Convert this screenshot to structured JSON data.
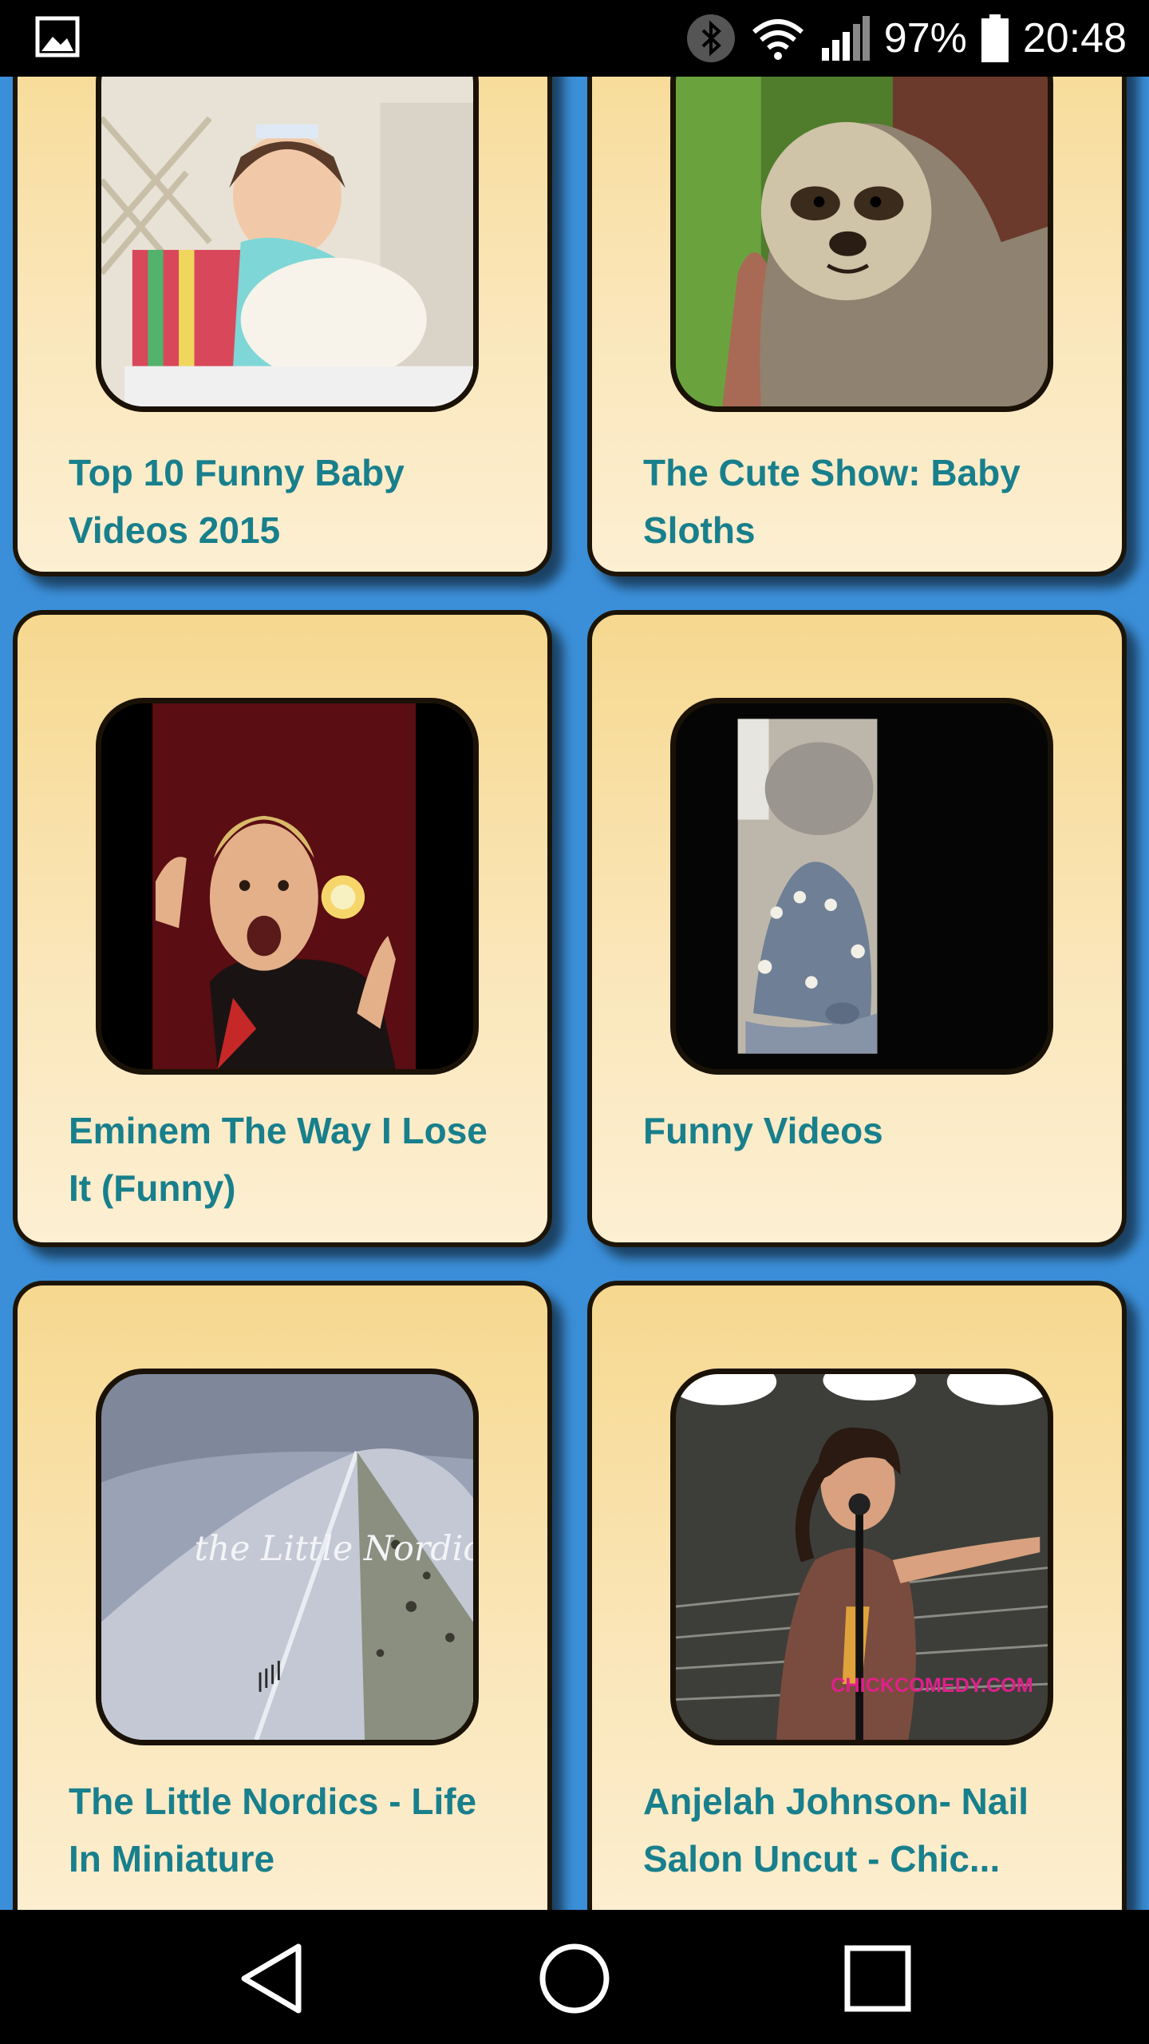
{
  "status_bar": {
    "battery_percent": "97%",
    "time": "20:48",
    "icons": [
      "gallery-notification-icon",
      "bluetooth-icon",
      "wifi-icon",
      "cell-signal-icon",
      "battery-icon"
    ]
  },
  "videos": [
    {
      "title": "Top 10 Funny Baby Videos 2015",
      "thumbnail": "baby-eating-cake"
    },
    {
      "title": "The Cute Show: Baby Sloths",
      "thumbnail": "baby-sloth"
    },
    {
      "title": "Eminem The Way I Lose It (Funny)",
      "thumbnail": "eminem-music-video"
    },
    {
      "title": "Funny Videos",
      "thumbnail": "cake-in-dark-frame"
    },
    {
      "title": "The Little Nordics - Life In Miniature",
      "thumbnail": "snowy-mountain",
      "thumbnail_overlay_text": "the Little Nordics"
    },
    {
      "title": "Anjelah Johnson- Nail Salon Uncut - Chic...",
      "thumbnail": "comedian-on-stage",
      "thumbnail_overlay_text": "CHICKCOMEDY.COM"
    }
  ],
  "nav_bar": {
    "back": "back-triangle-icon",
    "home": "home-circle-icon",
    "recents": "recents-square-icon"
  },
  "colors": {
    "background": "#3b8fd9",
    "card_top": "#f6d88f",
    "card_bottom": "#fcefd2",
    "title_text": "#187f8c"
  }
}
